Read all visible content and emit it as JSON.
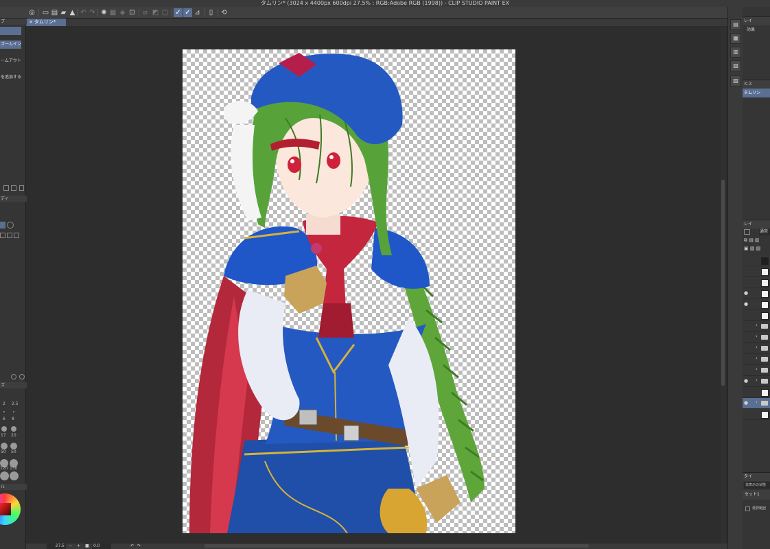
{
  "window": {
    "title": "タムリン* (3024 x 4400px 600dpi 27.5% : RGB:Adobe RGB (1998))  - CLIP STUDIO PAINT EX"
  },
  "document_tab": {
    "label": "タムリン*"
  },
  "left_panel": {
    "navigator_header": "プ",
    "zoom_in": "ズームイン",
    "zoom_out": "ームアウト",
    "add_item": "を追加する",
    "property_header": "ディ",
    "brush_header": "ズ",
    "color_header": "ル",
    "brush_sizes": [
      "2",
      "2.5",
      "6",
      "8",
      "17",
      "20",
      "50",
      "50",
      "120",
      "150"
    ]
  },
  "status_bar": {
    "zoom_value": "27.5",
    "rotation_value": "0.0"
  },
  "right_panels": {
    "layer_property_header": "レイ",
    "layer_property_effect": "効果",
    "history_header": "ヒス",
    "history_item": "タムリン",
    "layer_header": "レイ",
    "blend_mode": "通常",
    "timeline_header": "タイ",
    "timeline_select": "非表示の状態",
    "timeline_set": "セット1",
    "timeline_checkbox": "選択範囲"
  },
  "colors": {
    "accent": "#5a6f92",
    "background": "#2b2b2b"
  }
}
